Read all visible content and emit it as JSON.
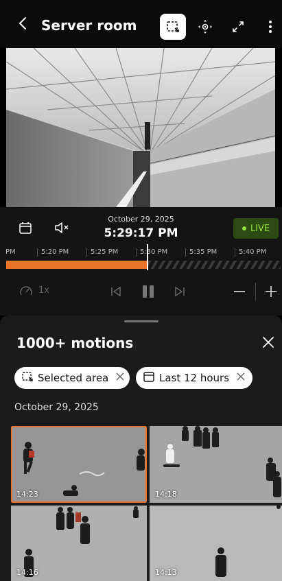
{
  "header": {
    "title": "Server room",
    "icons": [
      "back-icon",
      "selection-area-icon",
      "ptz-icon",
      "expand-icon",
      "more-vert-icon"
    ]
  },
  "player": {
    "date": "October 29, 2025",
    "time": "5:29:17 PM",
    "live_label": "LIVE",
    "speed_label": "1x",
    "timeline_ticks": [
      "PM",
      "5:20 PM",
      "5:25 PM",
      "5:30 PM",
      "5:35 PM",
      "5:40 PM"
    ]
  },
  "panel": {
    "title": "1000+ motions",
    "filters": [
      {
        "label": "Selected area",
        "icon": "selection-area-icon"
      },
      {
        "label": "Last 12 hours",
        "icon": "calendar-icon"
      }
    ],
    "section_date": "October 29, 2025",
    "thumbnails": [
      {
        "time": "14:23",
        "selected": true
      },
      {
        "time": "14:18",
        "selected": false
      },
      {
        "time": "14:16",
        "selected": false
      },
      {
        "time": "14:13",
        "selected": false
      }
    ]
  },
  "colors": {
    "accent": "#e8742c",
    "live_bg": "#2d4a12",
    "live_fg": "#8fe03c"
  }
}
